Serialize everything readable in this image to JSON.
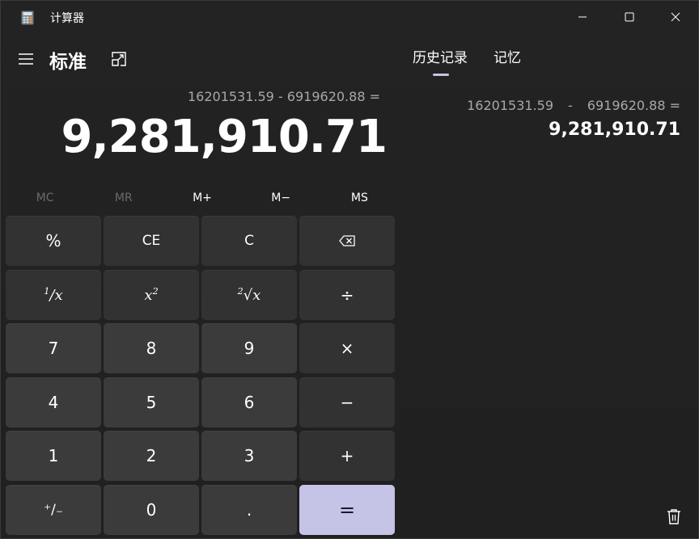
{
  "window": {
    "title": "计算器",
    "icon": "calculator-icon"
  },
  "header": {
    "mode_title": "标准",
    "menu_icon": "hamburger-icon",
    "keep_on_top_icon": "keep-on-top-icon"
  },
  "display": {
    "expression": "16201531.59 - 6919620.88 =",
    "result": "9,281,910.71"
  },
  "memory_buttons": [
    {
      "label": "MC",
      "enabled": false
    },
    {
      "label": "MR",
      "enabled": false
    },
    {
      "label": "M+",
      "enabled": true
    },
    {
      "label": "M−",
      "enabled": true
    },
    {
      "label": "MS",
      "enabled": true
    }
  ],
  "keypad": {
    "percent": "%",
    "ce": "CE",
    "c": "C",
    "backspace_icon": "backspace-icon",
    "reciprocal_num": "1",
    "reciprocal_x": "x",
    "square_x": "x",
    "square_exp": "2",
    "sqrt_index": "2",
    "sqrt_x": "x",
    "divide": "÷",
    "multiply": "×",
    "minus": "−",
    "plus": "+",
    "equals": "=",
    "negate": "⁺∕₋",
    "decimal": ".",
    "digits": {
      "d0": "0",
      "d1": "1",
      "d2": "2",
      "d3": "3",
      "d4": "4",
      "d5": "5",
      "d6": "6",
      "d7": "7",
      "d8": "8",
      "d9": "9"
    }
  },
  "panel": {
    "tabs": [
      {
        "label": "历史记录",
        "active": true
      },
      {
        "label": "记忆",
        "active": false
      }
    ],
    "history": [
      {
        "operand1": "16201531.59",
        "operator": "-",
        "operand2": "6919620.88 =",
        "result": "9,281,910.71"
      }
    ],
    "delete_icon": "trash-icon"
  },
  "colors": {
    "accent": "#c5c3e6",
    "background": "#202020",
    "number_key": "#3b3b3b",
    "operator_key": "#323232"
  }
}
